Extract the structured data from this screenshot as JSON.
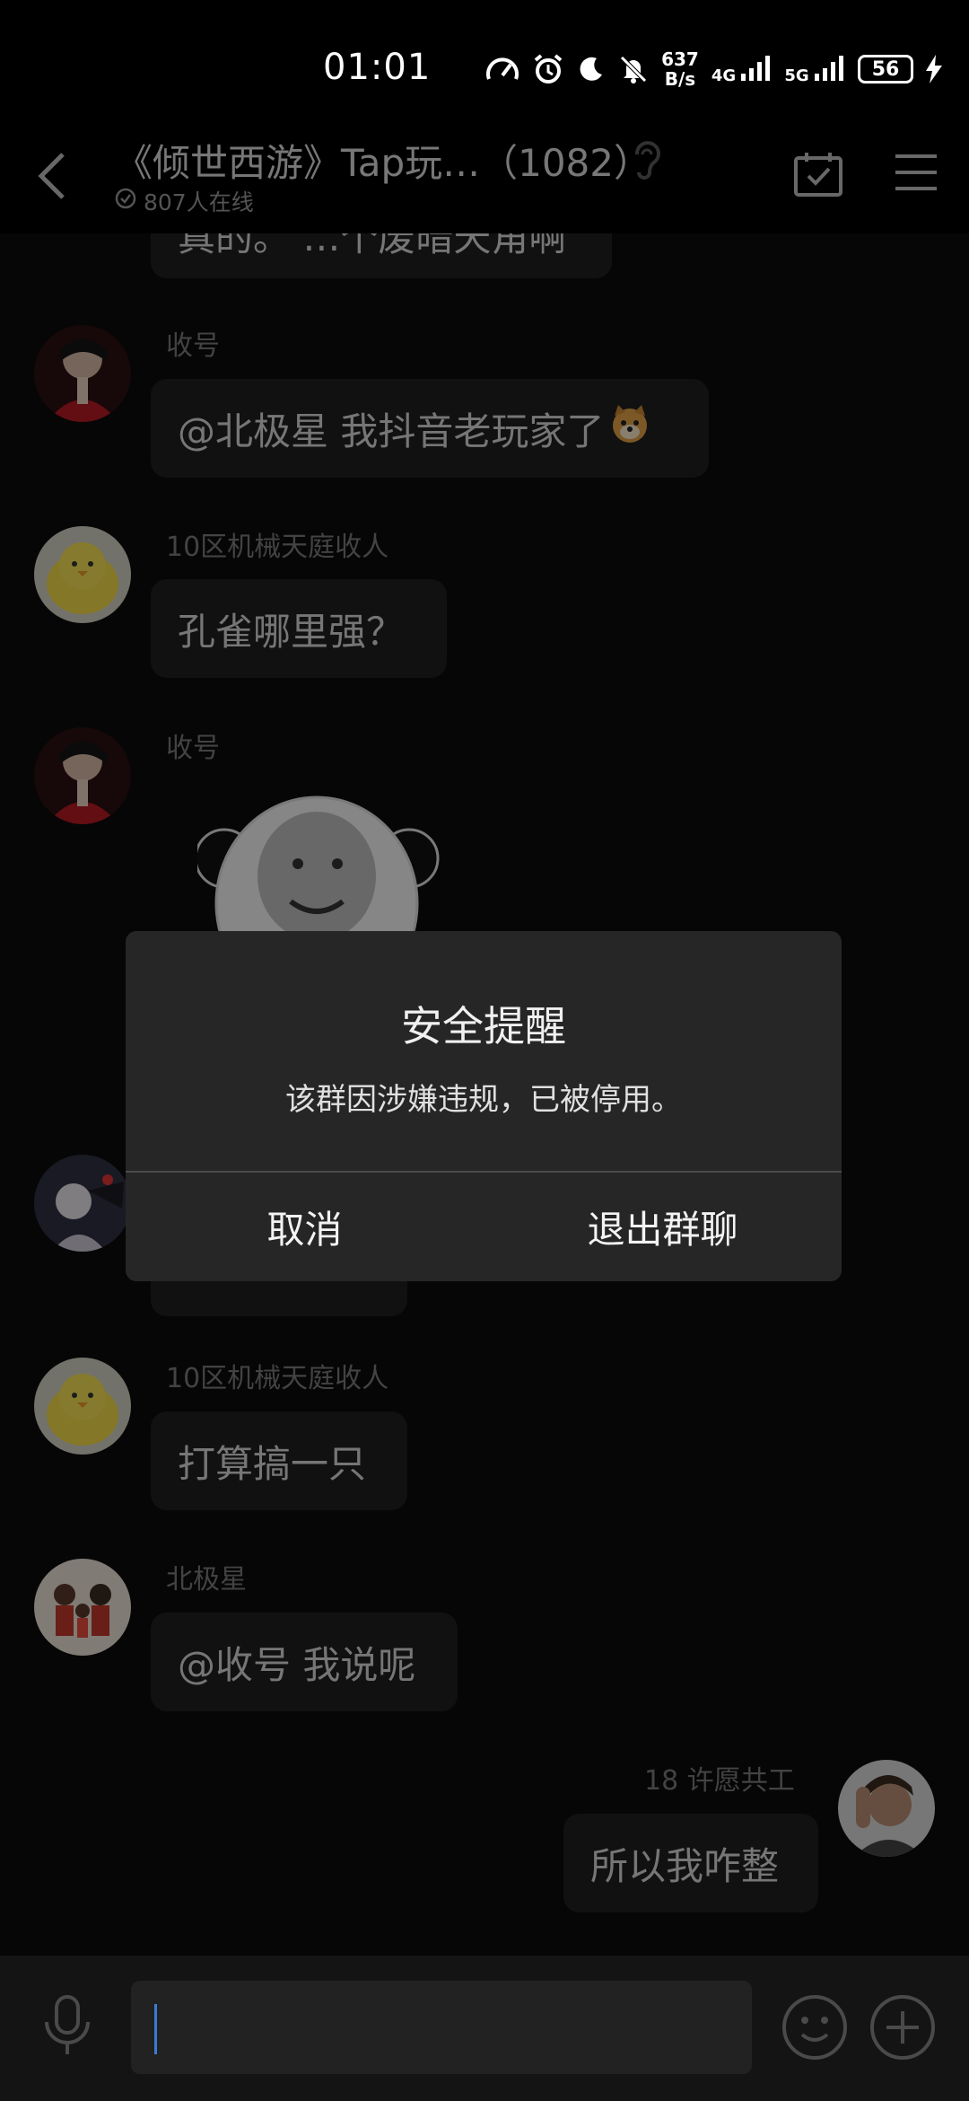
{
  "status_bar": {
    "time": "01:01",
    "net_speed_value": "637",
    "net_speed_unit": "B/s",
    "network_1": "4G",
    "network_2": "5G",
    "battery": "56"
  },
  "header": {
    "title": "《倾世西游》Tap玩…（1082）",
    "online": "807人在线"
  },
  "messages": [
    {
      "sender": "",
      "text": "真的。  …个废暗天角啊"
    },
    {
      "sender": "收号",
      "text": "@北极星 我抖音老玩家了"
    },
    {
      "sender": "10区机械天庭收人",
      "text": "孔雀哪里强？"
    },
    {
      "sender": "收号",
      "text": ""
    },
    {
      "sender": "10区机械天庭收人",
      "text": "打算搞一只"
    },
    {
      "sender": "北极星",
      "text": "@收号 我说呢"
    },
    {
      "sender": "18 许愿共工",
      "text": "所以我咋整"
    }
  ],
  "dialog": {
    "title": "安全提醒",
    "message": "该群因涉嫌违规，已被停用。",
    "cancel_label": "取消",
    "exit_label": "退出群聊"
  },
  "icons": {
    "back": "back-arrow-icon",
    "ear": "ear-icon",
    "calendar": "calendar-check-icon",
    "menu": "menu-icon",
    "mic": "microphone-icon",
    "emoji": "emoji-icon",
    "plus": "plus-icon"
  },
  "colors": {
    "background": "#0b0b0b",
    "bubble": "#202020",
    "dialog": "#262626",
    "caret": "#3a7bd5"
  }
}
